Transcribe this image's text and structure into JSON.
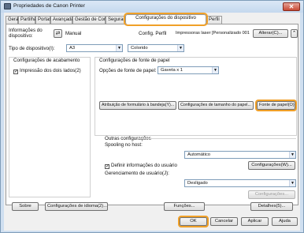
{
  "window": {
    "title": "Propriedades de Canon Printer",
    "close_glyph": "✕"
  },
  "tabs": [
    "Geral",
    "Partilha",
    "Portas",
    "Avançadas",
    "Gestão de Cores",
    "Segurança",
    "Configurações do dispositivo",
    "Perfil"
  ],
  "device_info": {
    "label": "Informações do dispositivo:",
    "mode_label": "Manual",
    "config_profile_label": "Config. Perfil",
    "config_profile_value": "Impressoras laser [Personalizado 001",
    "change_button": "Alterar(C)..."
  },
  "device_type": {
    "label": "Tipo de dispositivo(I):",
    "paper_size": "A3",
    "color_mode": "Colorido"
  },
  "finishing": {
    "group_label": "Configurações de acabamento",
    "duplex_label": "Impressão dos dois lados(2)",
    "duplex_checked": "✓"
  },
  "paper_source": {
    "group_label": "Configurações de fonte de papel",
    "options_label": "Opções de fonte de papel:",
    "options_value": "Gaveta x 1",
    "drawer_assign_button": "Atribuição de formulário à bandeja(Y)...",
    "size_settings_button": "Configurações de tamanho do papel...",
    "paper_source_button": "Fonte de papel(O)..."
  },
  "other": {
    "group_label": "Outras configurações",
    "spooling_label": "Spooling no host:",
    "spooling_value": "Automático",
    "define_user_label": "Definir informações do usuário",
    "define_user_checked": "✓",
    "settings_button": "Configurações(W)...",
    "user_mgmt_label": "Gerenciamento de usuário(J):",
    "user_mgmt_value": "Desligado",
    "user_mgmt_settings_button": "Configurações..."
  },
  "bottom_bar": {
    "about_button": "Sobre",
    "language_button": "Configurações de idioma(2)...",
    "functions_button": "Funções...",
    "details_button": "Detalhes(5)..."
  },
  "dialog_buttons": {
    "ok": "OK",
    "cancel": "Cancelar",
    "apply": "Aplicar",
    "help": "Ajuda"
  },
  "highlight_color": "#f0a028"
}
